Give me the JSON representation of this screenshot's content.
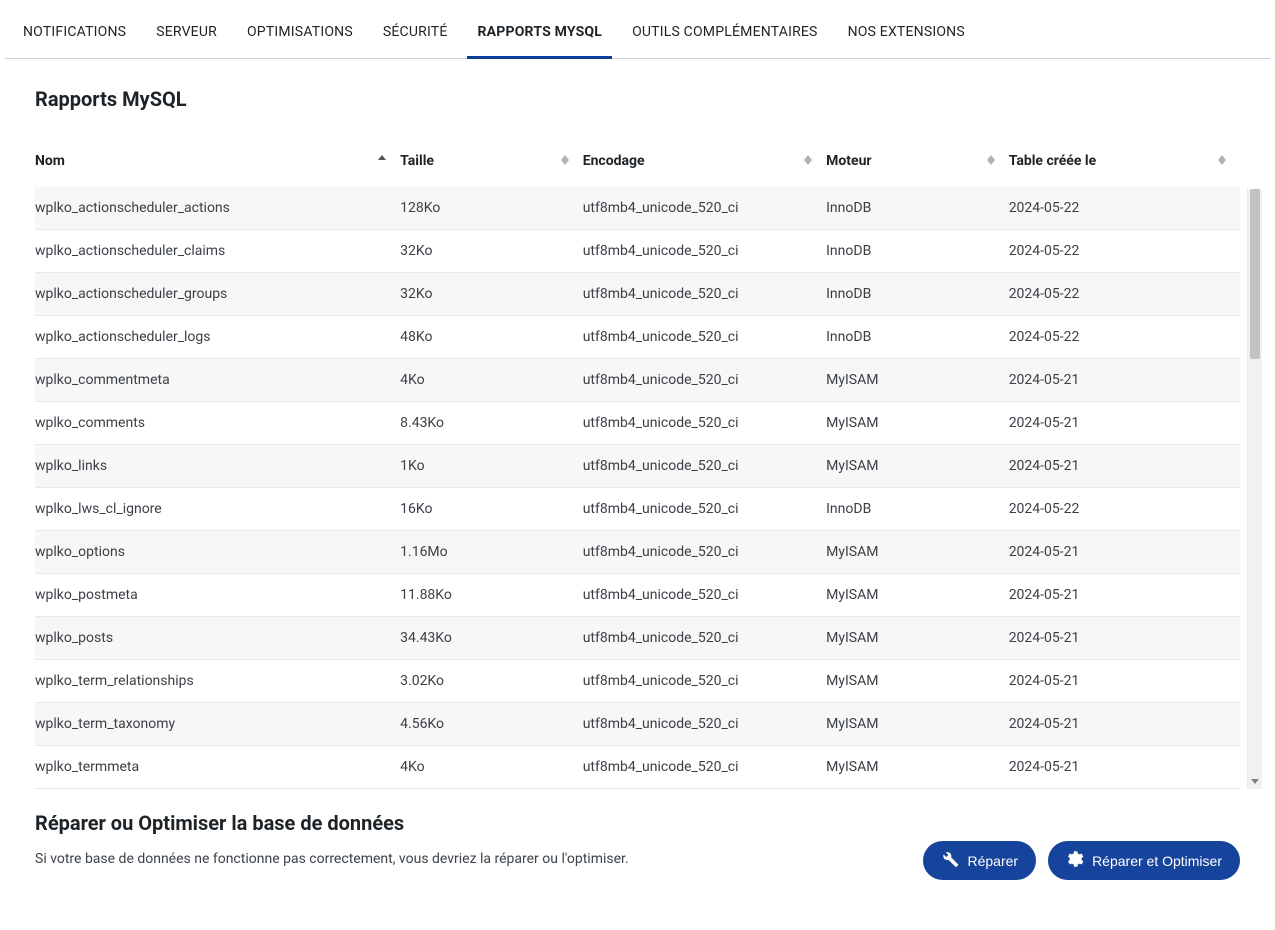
{
  "tabs": [
    {
      "label": "NOTIFICATIONS"
    },
    {
      "label": "SERVEUR"
    },
    {
      "label": "OPTIMISATIONS"
    },
    {
      "label": "SÉCURITÉ"
    },
    {
      "label": "RAPPORTS MYSQL",
      "active": true
    },
    {
      "label": "OUTILS COMPLÉMENTAIRES"
    },
    {
      "label": "NOS EXTENSIONS"
    }
  ],
  "page_title": "Rapports MySQL",
  "columns": {
    "nom": "Nom",
    "taille": "Taille",
    "encodage": "Encodage",
    "moteur": "Moteur",
    "date": "Table créée le"
  },
  "rows": [
    {
      "nom": "wplko_actionscheduler_actions",
      "taille": "128Ko",
      "enc": "utf8mb4_unicode_520_ci",
      "moteur": "InnoDB",
      "date": "2024-05-22"
    },
    {
      "nom": "wplko_actionscheduler_claims",
      "taille": "32Ko",
      "enc": "utf8mb4_unicode_520_ci",
      "moteur": "InnoDB",
      "date": "2024-05-22"
    },
    {
      "nom": "wplko_actionscheduler_groups",
      "taille": "32Ko",
      "enc": "utf8mb4_unicode_520_ci",
      "moteur": "InnoDB",
      "date": "2024-05-22"
    },
    {
      "nom": "wplko_actionscheduler_logs",
      "taille": "48Ko",
      "enc": "utf8mb4_unicode_520_ci",
      "moteur": "InnoDB",
      "date": "2024-05-22"
    },
    {
      "nom": "wplko_commentmeta",
      "taille": "4Ko",
      "enc": "utf8mb4_unicode_520_ci",
      "moteur": "MyISAM",
      "date": "2024-05-21"
    },
    {
      "nom": "wplko_comments",
      "taille": "8.43Ko",
      "enc": "utf8mb4_unicode_520_ci",
      "moteur": "MyISAM",
      "date": "2024-05-21"
    },
    {
      "nom": "wplko_links",
      "taille": "1Ko",
      "enc": "utf8mb4_unicode_520_ci",
      "moteur": "MyISAM",
      "date": "2024-05-21"
    },
    {
      "nom": "wplko_lws_cl_ignore",
      "taille": "16Ko",
      "enc": "utf8mb4_unicode_520_ci",
      "moteur": "InnoDB",
      "date": "2024-05-22"
    },
    {
      "nom": "wplko_options",
      "taille": "1.16Mo",
      "enc": "utf8mb4_unicode_520_ci",
      "moteur": "MyISAM",
      "date": "2024-05-21"
    },
    {
      "nom": "wplko_postmeta",
      "taille": "11.88Ko",
      "enc": "utf8mb4_unicode_520_ci",
      "moteur": "MyISAM",
      "date": "2024-05-21"
    },
    {
      "nom": "wplko_posts",
      "taille": "34.43Ko",
      "enc": "utf8mb4_unicode_520_ci",
      "moteur": "MyISAM",
      "date": "2024-05-21"
    },
    {
      "nom": "wplko_term_relationships",
      "taille": "3.02Ko",
      "enc": "utf8mb4_unicode_520_ci",
      "moteur": "MyISAM",
      "date": "2024-05-21"
    },
    {
      "nom": "wplko_term_taxonomy",
      "taille": "4.56Ko",
      "enc": "utf8mb4_unicode_520_ci",
      "moteur": "MyISAM",
      "date": "2024-05-21"
    },
    {
      "nom": "wplko_termmeta",
      "taille": "4Ko",
      "enc": "utf8mb4_unicode_520_ci",
      "moteur": "MyISAM",
      "date": "2024-05-21"
    }
  ],
  "footer": {
    "title": "Réparer ou Optimiser la base de données",
    "desc": "Si votre base de données ne fonctionne pas correctement, vous devriez la réparer ou l'optimiser.",
    "repair_label": "Réparer",
    "repair_opt_label": "Réparer et Optimiser"
  }
}
